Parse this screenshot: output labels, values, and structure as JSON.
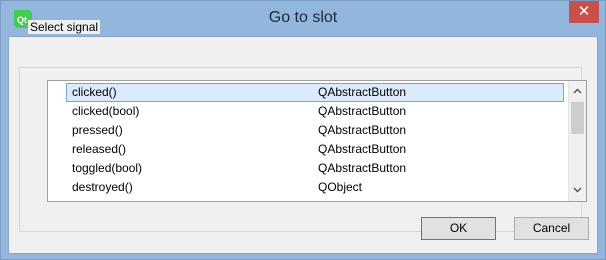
{
  "window": {
    "title": "Go to slot",
    "close_glyph": "✕"
  },
  "group": {
    "label": "Select signal"
  },
  "signals": [
    {
      "name": "clicked()",
      "class": "QAbstractButton",
      "selected": true
    },
    {
      "name": "clicked(bool)",
      "class": "QAbstractButton"
    },
    {
      "name": "pressed()",
      "class": "QAbstractButton"
    },
    {
      "name": "released()",
      "class": "QAbstractButton"
    },
    {
      "name": "toggled(bool)",
      "class": "QAbstractButton"
    },
    {
      "name": "destroyed()",
      "class": "QObject"
    }
  ],
  "buttons": {
    "ok": "OK",
    "cancel": "Cancel"
  },
  "colors": {
    "titlebar": "#93b7dc",
    "close": "#c9504a",
    "selection": "#dcebfc"
  }
}
